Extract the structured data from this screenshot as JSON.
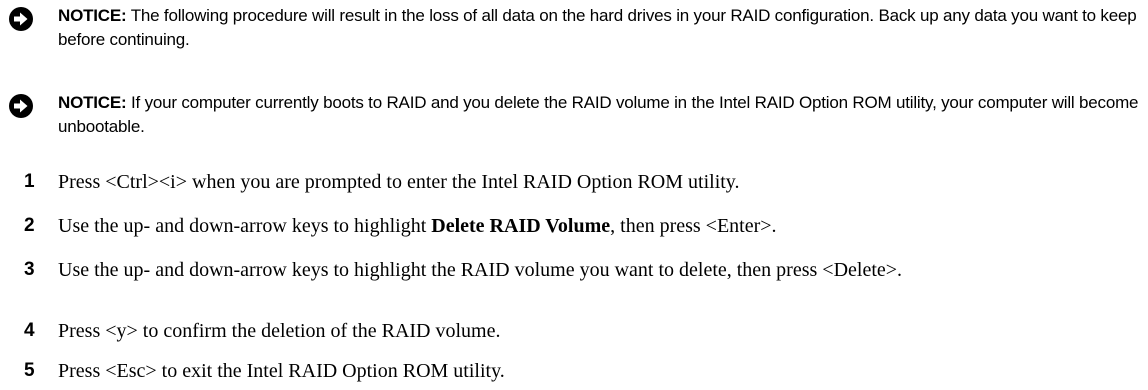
{
  "notices": [
    {
      "label": "NOTICE:",
      "text": " The following procedure will result in the loss of all data on the hard drives in your RAID configuration. Back up any data you want to keep before continuing.",
      "icon": "arrow-notice-icon"
    },
    {
      "label": "NOTICE:",
      "text": " If your computer currently boots to RAID and you delete the RAID volume in the Intel RAID Option ROM utility, your computer will become unbootable.",
      "icon": "arrow-notice-icon"
    }
  ],
  "steps": [
    {
      "num": "1",
      "text": "Press <Ctrl><i> when you are prompted to enter the Intel RAID Option ROM utility."
    },
    {
      "num": "2",
      "pre": "Use the up- and down-arrow keys to highlight ",
      "bold": "Delete RAID Volume",
      "post": ", then press <Enter>."
    },
    {
      "num": "3",
      "text": "Use the up- and down-arrow keys to highlight the RAID volume you want to delete, then press <Delete>."
    },
    {
      "num": "4",
      "text": "Press <y> to confirm the deletion of the RAID volume."
    },
    {
      "num": "5",
      "text": "Press <Esc> to exit the Intel RAID Option ROM utility."
    }
  ]
}
